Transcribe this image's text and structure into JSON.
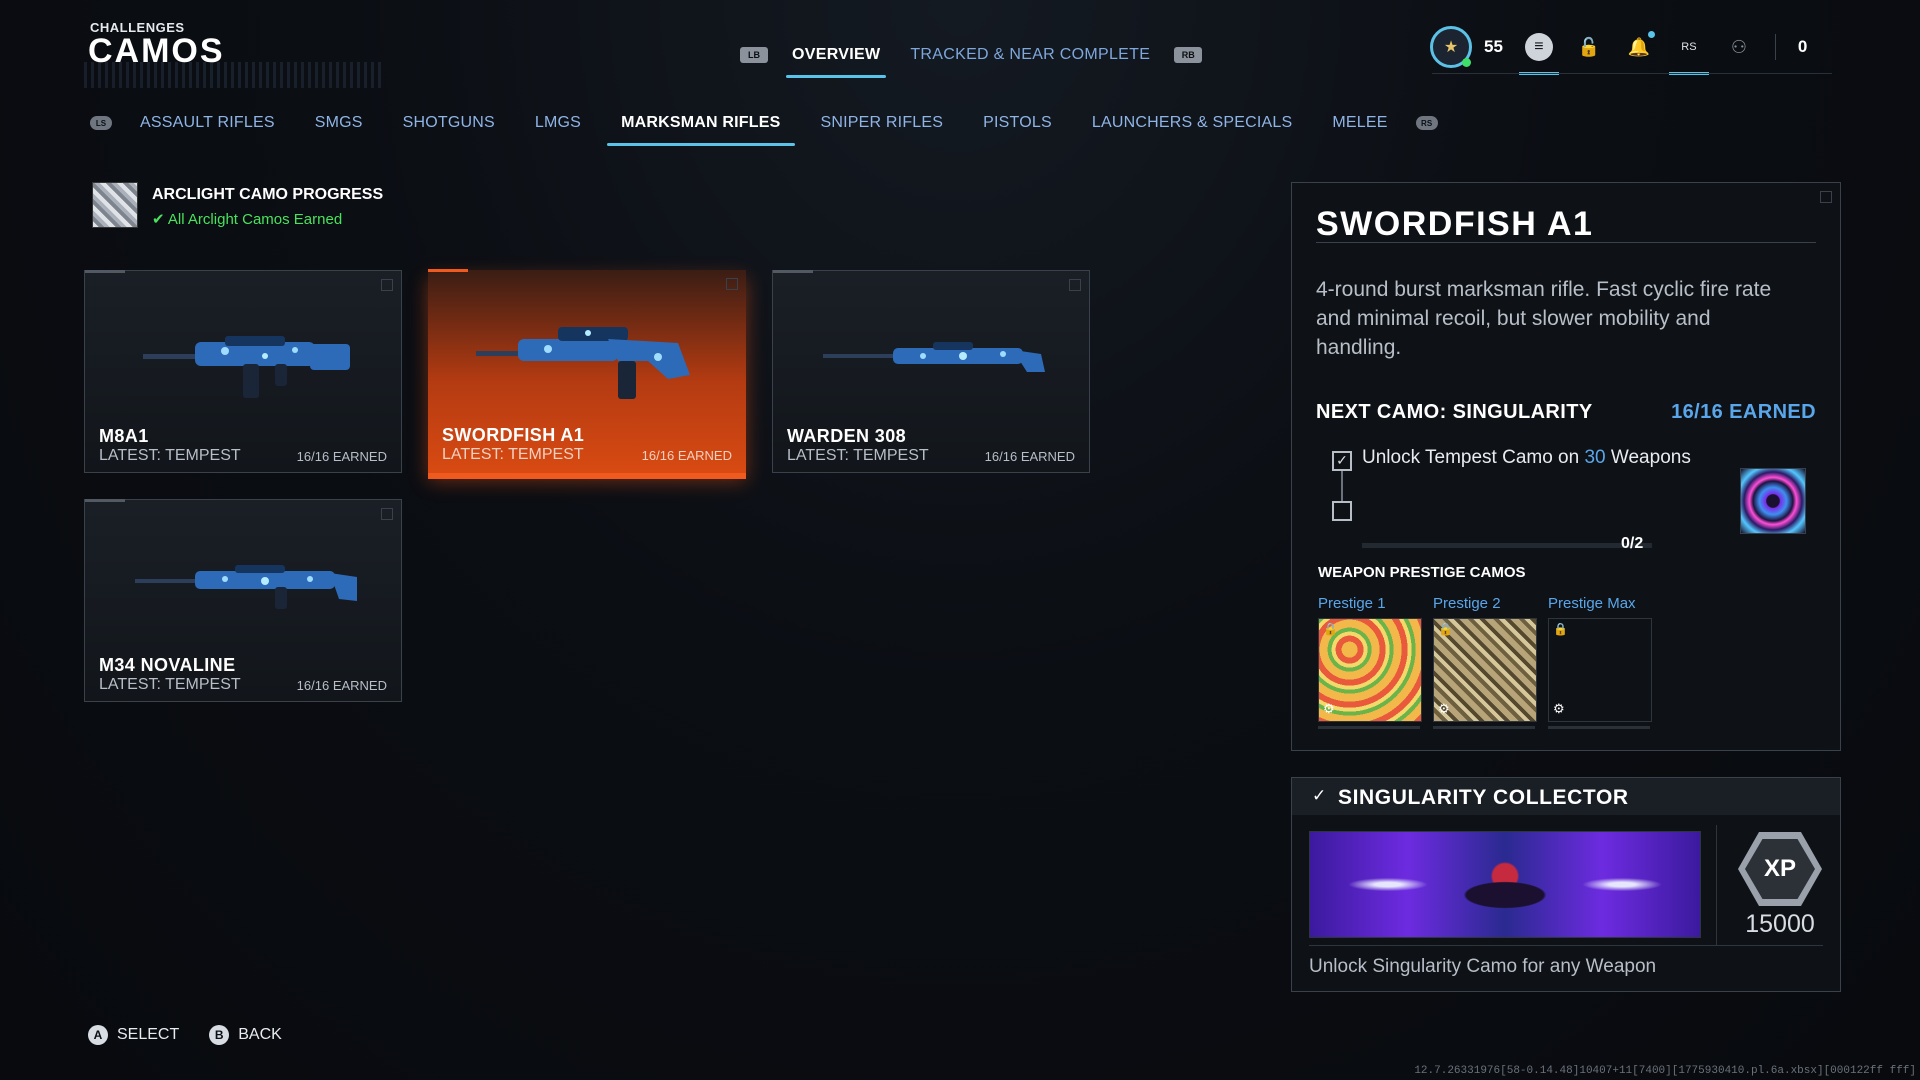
{
  "header": {
    "section": "CHALLENGES",
    "title": "CAMOS"
  },
  "top_nav": {
    "left_bumper": "LB",
    "right_bumper": "RB",
    "tabs": [
      {
        "label": "OVERVIEW",
        "active": true
      },
      {
        "label": "TRACKED & NEAR COMPLETE",
        "active": false
      }
    ]
  },
  "status_bar": {
    "level": "55",
    "rs_label": "RS",
    "currency": "0",
    "icons": [
      "rank-badge-icon",
      "menu-icon",
      "lock-icon",
      "notification-icon",
      "social-icon",
      "party-icon"
    ]
  },
  "categories": {
    "left_glyph": "LS",
    "right_glyph": "RS",
    "tabs": [
      {
        "label": "ASSAULT RIFLES",
        "active": false
      },
      {
        "label": "SMGS",
        "active": false
      },
      {
        "label": "SHOTGUNS",
        "active": false
      },
      {
        "label": "LMGS",
        "active": false
      },
      {
        "label": "MARKSMAN RIFLES",
        "active": true
      },
      {
        "label": "SNIPER RIFLES",
        "active": false
      },
      {
        "label": "PISTOLS",
        "active": false
      },
      {
        "label": "LAUNCHERS & SPECIALS",
        "active": false
      },
      {
        "label": "MELEE",
        "active": false
      }
    ]
  },
  "progress": {
    "title": "ARCLIGHT CAMO PROGRESS",
    "status": "All Arclight Camos Earned"
  },
  "weapons": [
    {
      "name": "M8A1",
      "latest": "LATEST: TEMPEST",
      "earned": "16/16 EARNED",
      "selected": false
    },
    {
      "name": "SWORDFISH A1",
      "latest": "LATEST: TEMPEST",
      "earned": "16/16 EARNED",
      "selected": true
    },
    {
      "name": "WARDEN 308",
      "latest": "LATEST: TEMPEST",
      "earned": "16/16 EARNED",
      "selected": false
    },
    {
      "name": "M34 NOVALINE",
      "latest": "LATEST: TEMPEST",
      "earned": "16/16 EARNED",
      "selected": false
    }
  ],
  "detail": {
    "title": "SWORDFISH A1",
    "description": "4-round burst marksman rifle. Fast cyclic fire rate and minimal recoil, but slower mobility and handling.",
    "next_camo": "NEXT CAMO: SINGULARITY",
    "earned": "16/16 EARNED",
    "task_prefix": "Unlock Tempest Camo on ",
    "task_number": "30",
    "task_suffix": " Weapons",
    "task_count": "0/2",
    "task_progress": 0.0,
    "prestige_heading": "WEAPON PRESTIGE CAMOS",
    "prestige": [
      {
        "label": "Prestige 1"
      },
      {
        "label": "Prestige 2"
      },
      {
        "label": "Prestige Max"
      }
    ]
  },
  "collector": {
    "title": "SINGULARITY COLLECTOR",
    "xp_label": "XP",
    "xp_value": "15000",
    "description": "Unlock Singularity Camo for any Weapon"
  },
  "footer": {
    "select_glyph": "A",
    "select_label": "SELECT",
    "back_glyph": "B",
    "back_label": "BACK"
  },
  "build_string": "12.7.26331976[58-0.14.48]10407+11[7400][1775930410.pl.6a.xbsx][000122ff fff]"
}
